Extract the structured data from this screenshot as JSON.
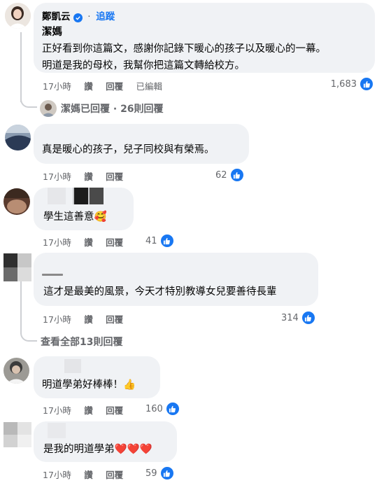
{
  "thread": {
    "replies_link": "查看全部13則回覆",
    "comments": [
      {
        "author": "鄭凱云",
        "follow_label": "追蹤",
        "mention": "潔媽",
        "lines": [
          "正好看到你這篇文，感謝你記錄下暖心的孩子以及暖心的一幕。",
          "明道是我的母校，我幫你把這篇文轉給校方。"
        ],
        "time": "17小時",
        "like_label": "讚",
        "reply_label": "回覆",
        "edited_label": "已編輯",
        "like_count": "1,683",
        "reply_summary": "潔媽已回覆 · 26則回覆"
      },
      {
        "text": "真是暖心的孩子，兒子同校與有榮焉。",
        "time": "17小時",
        "like_label": "讚",
        "reply_label": "回覆",
        "like_count": "62"
      },
      {
        "text": "學生這善意🥰",
        "time": "17小時",
        "like_label": "讚",
        "reply_label": "回覆",
        "like_count": "41"
      },
      {
        "text": "這才是最美的風景，今天才特別教導女兒要善待長輩",
        "time": "17小時",
        "like_label": "讚",
        "reply_label": "回覆",
        "like_count": "314"
      },
      {
        "text": "明道學弟好棒棒！👍",
        "time": "17小時",
        "like_label": "讚",
        "reply_label": "回覆",
        "like_count": "160"
      },
      {
        "text": "是我的明道學弟❤️❤️❤️",
        "time": "17小時",
        "like_label": "讚",
        "reply_label": "回覆",
        "like_count": "59"
      }
    ]
  },
  "colors": {
    "bubble": "#f0f2f5",
    "meta": "#65676b",
    "accent": "#1877f2"
  }
}
